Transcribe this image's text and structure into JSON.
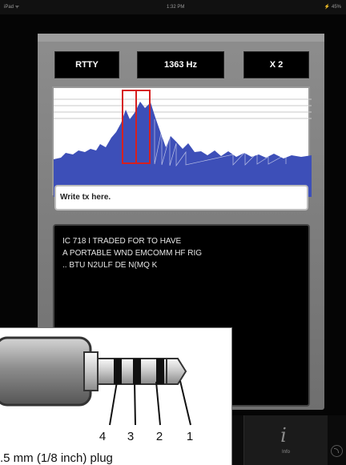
{
  "status_bar": {
    "device": "iPad ᯤ",
    "time": "1:32 PM",
    "battery": "⚡ 45%"
  },
  "mode_bar": {
    "mode": "RTTY",
    "frequency": "1363 Hz",
    "zoom": "X 2"
  },
  "tx": {
    "placeholder": "Write tx here."
  },
  "rx": {
    "lines": [
      "IC 718 I TRADED FOR TO HAVE",
      "A PORTABLE WND EMCOMM HF RIG",
      ".. BTU N2ULF DE N(MQ K"
    ]
  },
  "bottom_bar": {
    "info_label": "Info",
    "info_icon": "info-icon",
    "corner_icon": "refresh-icon"
  },
  "plug": {
    "contacts": [
      "4",
      "3",
      "2",
      "1"
    ],
    "caption": ".5 mm (1/8 inch) plug"
  },
  "colors": {
    "waterfall_fill": "#3d4fb8",
    "marker_red": "#d62020",
    "panel_gray": "#7f7f7f"
  }
}
